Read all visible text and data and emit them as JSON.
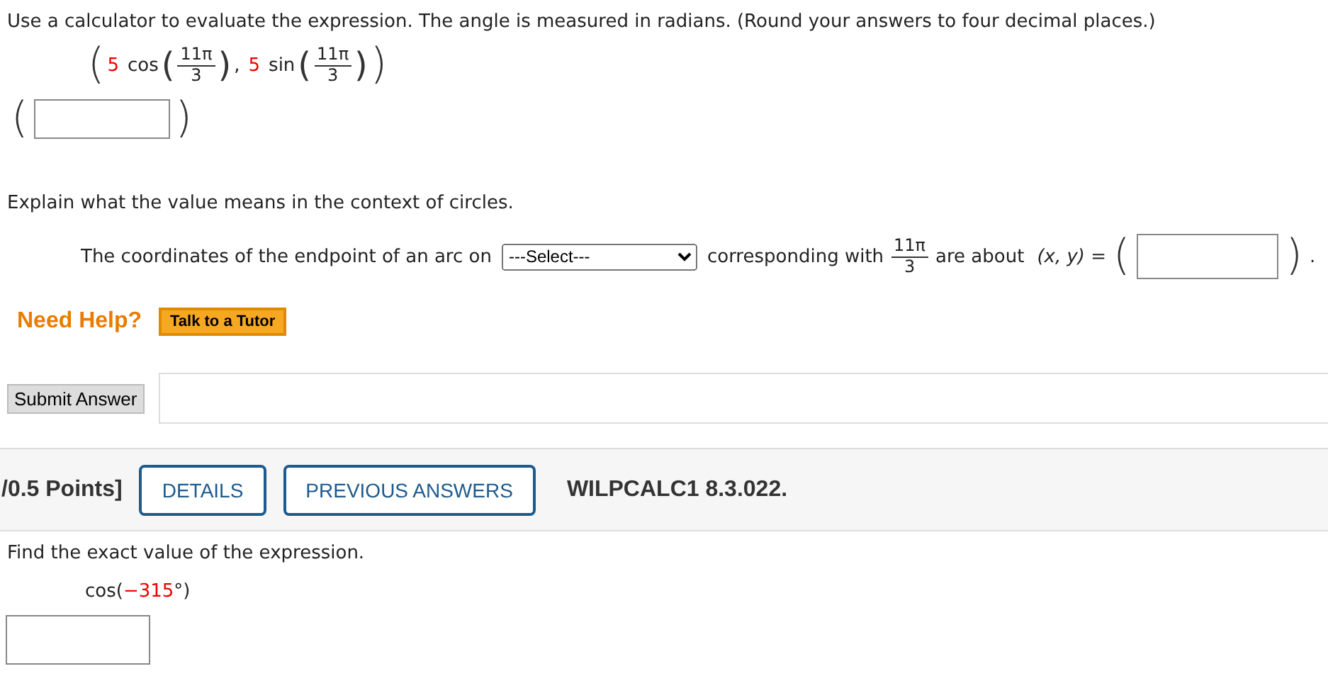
{
  "q1": {
    "instruction": "Use a calculator to evaluate the expression. The angle is measured in radians. (Round your answers to four decimal places.)",
    "expression": {
      "open": "(",
      "close": ")",
      "sep": ",",
      "terms": [
        {
          "coef": "5",
          "func": "cos",
          "open": "(",
          "numerator": "11π",
          "denominator": "3",
          "close": ")"
        },
        {
          "coef": "5",
          "func": "sin",
          "open": "(",
          "numerator": "11π",
          "denominator": "3",
          "close": ")"
        }
      ]
    },
    "answer": {
      "open": "(",
      "close": ")"
    },
    "explain": "Explain what the value means in the context of circles.",
    "sentence": {
      "before": "The coordinates of the endpoint of an arc on",
      "select": "---Select---",
      "middle": "corresponding with",
      "numerator": "11π",
      "denominator": "3",
      "after": "are about",
      "pair": "(x, y) =",
      "open": "(",
      "close": ")",
      "end": "."
    },
    "help": {
      "label": "Need Help?",
      "button": "Talk to a Tutor"
    },
    "submit": "Submit Answer"
  },
  "q2": {
    "points": "/0.5 Points]",
    "buttons": [
      "DETAILS",
      "PREVIOUS ANSWERS"
    ],
    "code": "WILPCALC1 8.3.022.",
    "instruction": "Find the exact value of the expression.",
    "expression": {
      "func": "cos(",
      "value": "−315",
      "unit": "°",
      "close": ")"
    }
  }
}
